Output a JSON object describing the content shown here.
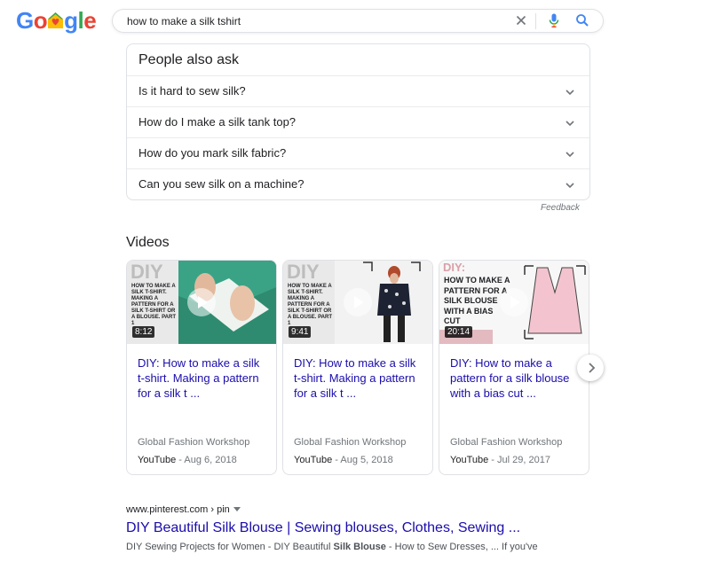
{
  "header": {
    "logo_letters": [
      "G",
      "o",
      "g",
      "l",
      "e"
    ],
    "search_value": "how to make a silk tshirt"
  },
  "people_also_ask": {
    "title": "People also ask",
    "questions": [
      "Is it hard to sew silk?",
      "How do I make a silk tank top?",
      "How do you mark silk fabric?",
      "Can you sew silk on a machine?"
    ],
    "feedback_label": "Feedback"
  },
  "videos": {
    "title": "Videos",
    "items": [
      {
        "thumb_word": "DIY",
        "thumb_text": "HOW TO MAKE A SILK T-SHIRT. MAKING A PATTERN FOR A SILK T-SHIRT OR A BLOUSE. PART 1",
        "duration": "8:12",
        "title": "DIY: How to make a silk t-shirt. Making a pattern for a silk t ...",
        "channel": "Global Fashion Workshop",
        "source": "YouTube",
        "date": "Aug 6, 2018"
      },
      {
        "thumb_word": "DIY",
        "thumb_text": "HOW TO MAKE A SILK T-SHIRT. MAKING A PATTERN FOR A SILK T-SHIRT OR A BLOUSE. PART 1",
        "duration": "9:41",
        "title": "DIY: How to make a silk t-shirt. Making a pattern for a silk t ...",
        "channel": "Global Fashion Workshop",
        "source": "YouTube",
        "date": "Aug 5, 2018"
      },
      {
        "thumb_word": "DIY:",
        "thumb_text": "HOW TO MAKE A PATTERN FOR A SILK BLOUSE WITH A BIAS CUT",
        "duration": "20:14",
        "title": "DIY: How to make a pattern for a silk blouse with a bias cut ...",
        "channel": "Global Fashion Workshop",
        "source": "YouTube",
        "date": "Jul 29, 2017"
      }
    ]
  },
  "result": {
    "url": "www.pinterest.com › pin",
    "title": "DIY Beautiful Silk Blouse | Sewing blouses, Clothes, Sewing ...",
    "snippet_before": "DIY Sewing Projects for Women - DIY Beautiful ",
    "snippet_bold": "Silk Blouse",
    "snippet_after": " - How to Sew Dresses, ... If you've"
  },
  "colors": {
    "link": "#1a0dab",
    "meta": "#70757a",
    "border": "#dfe1e5"
  }
}
